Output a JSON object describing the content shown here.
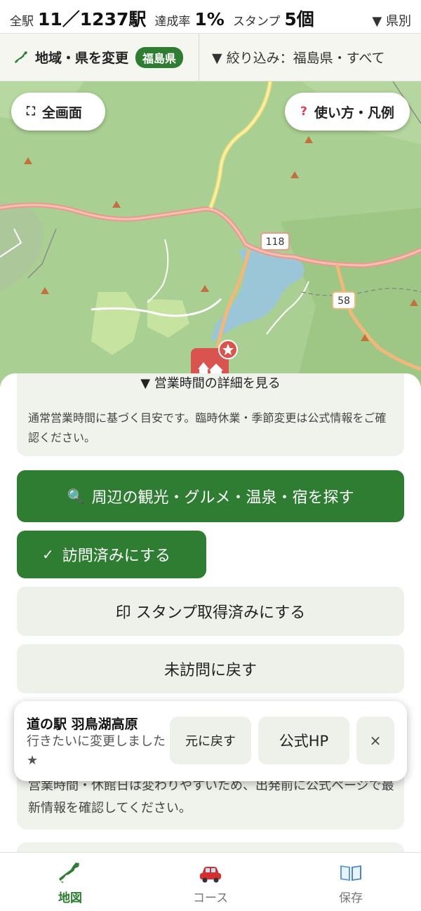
{
  "stats": {
    "total_label": "全駅",
    "total_value": "11／1237駅",
    "rate_label": "達成率",
    "rate_value": "1%",
    "stamp_label": "スタンプ",
    "stamp_value": "5個",
    "filter_toggle": "▼ 県別"
  },
  "region": {
    "change_label": "地域・県を変更",
    "pref_badge": "福島県",
    "filter_label": "▼ 絞り込み：福島県・すべて"
  },
  "map": {
    "fullscreen_label": "全画面",
    "help_label": "使い方・凡例",
    "route_labels": [
      "118",
      "58"
    ],
    "colors": {
      "forest": "#a9cf92",
      "lake": "#9bc6d8",
      "road_main": "#e89b8b",
      "road_yellow": "#f2e07a",
      "peak": "#c0713e",
      "marker": "#d9534f"
    }
  },
  "sheet": {
    "hours_toggle": "▼ 営業時間の詳細を見る",
    "hours_note": "通常営業時間に基づく目安です。臨時休業・季節変更は公式情報をご確認ください。",
    "search_label": "周辺の観光・グルメ・温泉・宿を探す",
    "visit_label": "訪問済みにする",
    "stamp_label": "印 スタンプ取得済みにする",
    "unvisit_label": "未訪問に戻す",
    "bottom_note": "営業時間・休館日は変わりやすいため、出発前に公式ページで最新情報を確認してください。"
  },
  "toast": {
    "title": "道の駅 羽鳥湖高原",
    "message": "行きたいに変更しました ★",
    "undo_label": "元に戻す",
    "hp_label": "公式HP",
    "close_label": "×"
  },
  "nav": {
    "items": [
      {
        "label": "地図",
        "icon": "japan-map-icon",
        "active": true
      },
      {
        "label": "コース",
        "icon": "car-icon",
        "active": false
      },
      {
        "label": "保存",
        "icon": "book-icon",
        "active": false
      }
    ],
    "accent": "#2e7d32"
  }
}
